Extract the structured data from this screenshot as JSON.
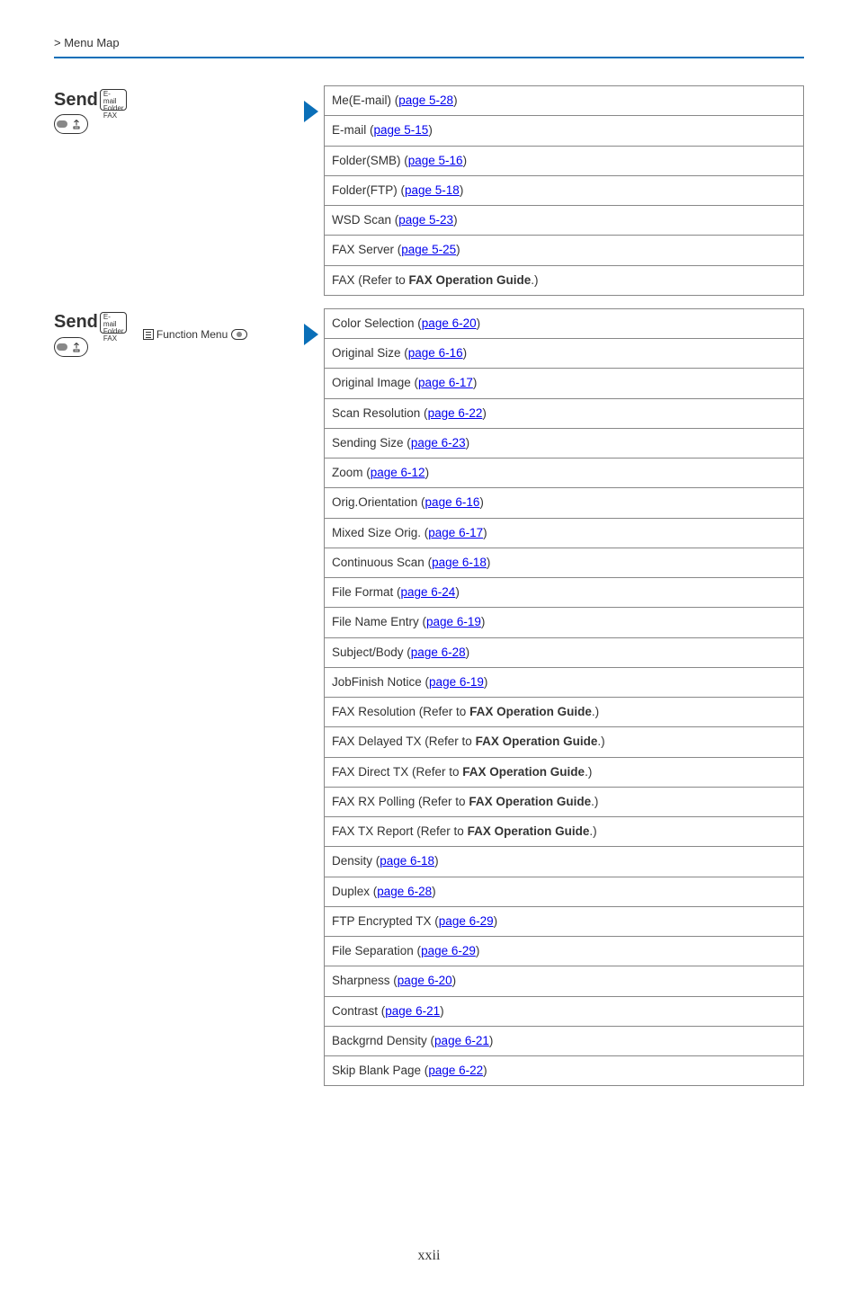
{
  "header": "> Menu Map",
  "footer": "xxii",
  "send_label": "Send",
  "send_sub1": "E-mail",
  "send_sub2": "Folder",
  "send_sub3": "FAX",
  "fn_menu": "Function Menu",
  "table1": [
    {
      "pre": "Me(E-mail) (",
      "link": "page 5-28",
      "post": ")"
    },
    {
      "pre": "E-mail (",
      "link": "page 5-15",
      "post": ")"
    },
    {
      "pre": "Folder(SMB) (",
      "link": "page 5-16",
      "post": ")"
    },
    {
      "pre": "Folder(FTP) (",
      "link": "page 5-18",
      "post": ")"
    },
    {
      "pre": "WSD Scan (",
      "link": "page 5-23",
      "post": ")"
    },
    {
      "pre": "FAX Server (",
      "link": "page 5-25",
      "post": ")"
    },
    {
      "pre": "FAX (Refer to ",
      "bold": "FAX Operation Guide",
      "post": ".)"
    }
  ],
  "table2": [
    {
      "pre": "Color Selection (",
      "link": "page 6-20",
      "post": ")"
    },
    {
      "pre": "Original Size (",
      "link": "page 6-16",
      "post": ")"
    },
    {
      "pre": "Original Image (",
      "link": "page 6-17",
      "post": ")"
    },
    {
      "pre": "Scan Resolution (",
      "link": "page 6-22",
      "post": ")"
    },
    {
      "pre": "Sending Size (",
      "link": "page 6-23",
      "post": ")"
    },
    {
      "pre": "Zoom (",
      "link": "page 6-12",
      "post": ")"
    },
    {
      "pre": "Orig.Orientation (",
      "link": "page 6-16",
      "post": ")"
    },
    {
      "pre": "Mixed Size Orig. (",
      "link": "page 6-17",
      "post": ")"
    },
    {
      "pre": "Continuous Scan (",
      "link": "page 6-18",
      "post": ")"
    },
    {
      "pre": "File Format (",
      "link": "page 6-24",
      "post": ")"
    },
    {
      "pre": "File Name Entry (",
      "link": "page 6-19",
      "post": ")"
    },
    {
      "pre": "Subject/Body (",
      "link": "page 6-28",
      "post": ")"
    },
    {
      "pre": "JobFinish Notice (",
      "link": "page 6-19",
      "post": ")"
    },
    {
      "pre": "FAX Resolution (Refer to ",
      "bold": "FAX Operation Guide",
      "post": ".)"
    },
    {
      "pre": "FAX Delayed TX (Refer to ",
      "bold": "FAX Operation Guide",
      "post": ".)"
    },
    {
      "pre": "FAX Direct TX (Refer to ",
      "bold": "FAX Operation Guide",
      "post": ".)"
    },
    {
      "pre": "FAX RX Polling (Refer to ",
      "bold": "FAX Operation Guide",
      "post": ".)"
    },
    {
      "pre": "FAX TX Report (Refer to ",
      "bold": "FAX Operation Guide",
      "post": ".)"
    },
    {
      "pre": "Density (",
      "link": "page 6-18",
      "post": ")"
    },
    {
      "pre": "Duplex (",
      "link": "page 6-28",
      "post": ")"
    },
    {
      "pre": "FTP Encrypted TX (",
      "link": "page 6-29",
      "post": ")"
    },
    {
      "pre": "File Separation (",
      "link": "page 6-29",
      "post": ")"
    },
    {
      "pre": "Sharpness (",
      "link": "page 6-20",
      "post": ")"
    },
    {
      "pre": "Contrast (",
      "link": "page 6-21",
      "post": ")"
    },
    {
      "pre": "Backgrnd Density (",
      "link": "page 6-21",
      "post": ")"
    },
    {
      "pre": "Skip Blank Page (",
      "link": "page 6-22",
      "post": ")"
    }
  ]
}
